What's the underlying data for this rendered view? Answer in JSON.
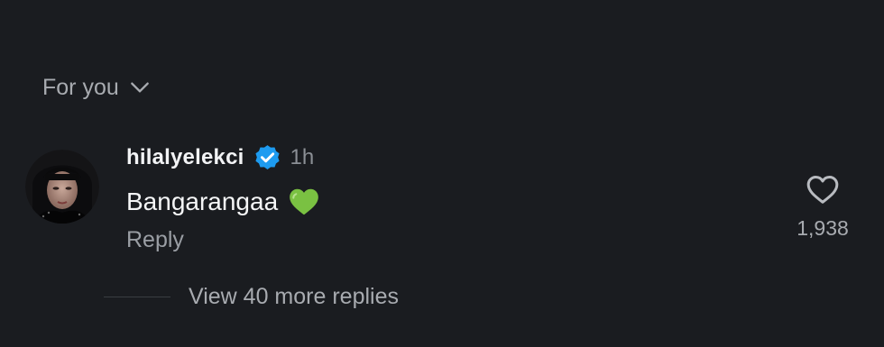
{
  "filter": {
    "label": "For you",
    "icon": "chevron-down-icon"
  },
  "comment": {
    "avatar_icon": "user-avatar",
    "username": "hilalyelekci",
    "verified_icon": "verified-badge-icon",
    "verified_color": "#1d9bf0",
    "time": "1h",
    "text": "Bangarangaa",
    "emoji_icon": "green-heart-icon",
    "emoji_color": "#7ac142",
    "reply_label": "Reply",
    "like_icon": "heart-outline-icon",
    "like_count": "1,938"
  },
  "replies": {
    "label": "View 40 more replies"
  }
}
